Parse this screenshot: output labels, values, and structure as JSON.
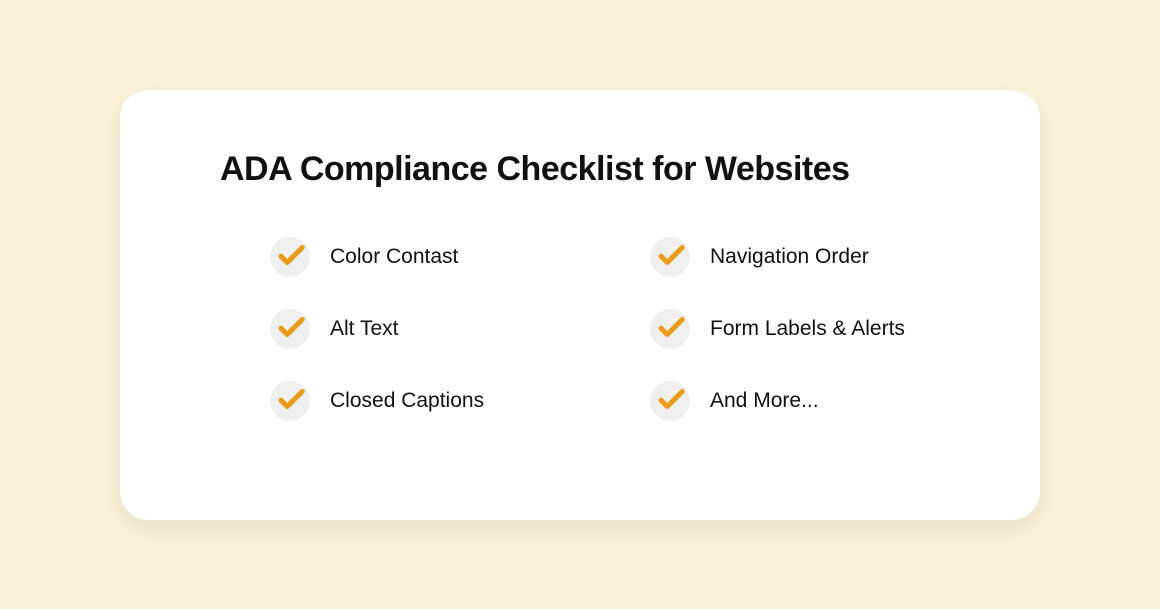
{
  "title": "ADA Compliance Checklist for Websites",
  "checklist": {
    "items": [
      {
        "label": "Color Contast"
      },
      {
        "label": "Navigation Order"
      },
      {
        "label": "Alt Text"
      },
      {
        "label": "Form Labels & Alerts"
      },
      {
        "label": "Closed Captions"
      },
      {
        "label": "And More..."
      }
    ]
  },
  "colors": {
    "accent": "#e89c18",
    "background": "#faf1d9",
    "card": "#ffffff",
    "text": "#111111",
    "iconBg": "#efefef"
  }
}
